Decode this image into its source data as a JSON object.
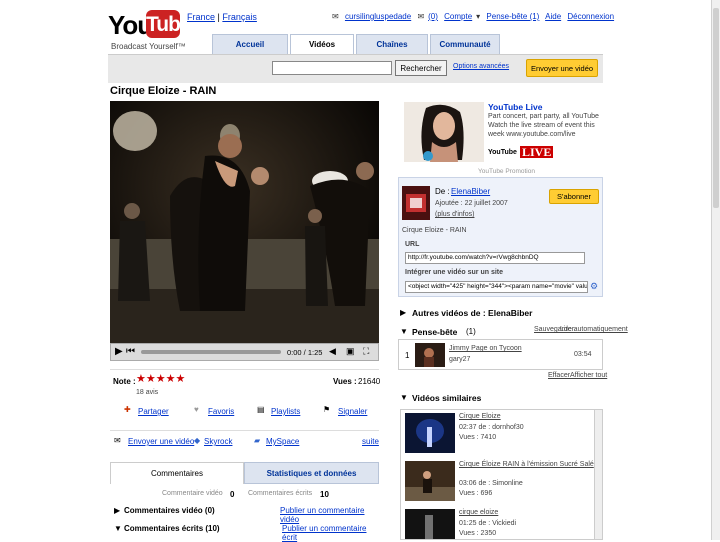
{
  "header": {
    "logo_you": "You",
    "logo_tube": "Tube",
    "tagline": "Broadcast Yourself™",
    "lang_fr": "France",
    "lang_fr2": "Français",
    "user": "cursilingluspedade",
    "inbox": "(0)",
    "account": "Compte",
    "playlist_count": "Pense-bête (1)",
    "help": "Aide",
    "logout": "Déconnexion"
  },
  "tabs": [
    "Accueil",
    "Vidéos",
    "Chaînes",
    "Communauté"
  ],
  "search": {
    "button": "Rechercher",
    "advanced": "Options avancées",
    "upload": "Envoyer une vidéo"
  },
  "video": {
    "title": "Cirque Eloize - RAIN",
    "time": "0:00 / 1:25"
  },
  "rating": {
    "label": "Note :",
    "count": "18 avis",
    "views_label": "Vues :",
    "views": "21640"
  },
  "actions": {
    "share": "Partager",
    "favorite": "Favoris",
    "playlists": "Playlists",
    "flag": "Signaler",
    "send": "Envoyer une vidéo",
    "skyrock": "Skyrock",
    "myspace": "MySpace",
    "more": "suite"
  },
  "comments_tabs": {
    "comments": "Commentaires",
    "stats": "Statistiques et données"
  },
  "comments": {
    "video_comments_label": "Commentaire vidéo",
    "video_comments_count": "0",
    "written_comments_label": "Commentaires écrits",
    "written_comments_count": "10",
    "video_row": "Commentaires vidéo (0)",
    "video_publish": "Publier un commentaire vidéo",
    "written_row": "Commentaires écrits (10)",
    "written_publish": "Publier un commentaire écrit"
  },
  "promo": {
    "title": "YouTube Live",
    "text1": "Part concert, part party, all YouTube",
    "text2": "Watch the live stream of event this",
    "text3": "week www.youtube.com/live",
    "brand": "YouTube",
    "live": "LIVE",
    "caption": "YouTube Promotion"
  },
  "channel": {
    "from_label": "De :",
    "user": "ElenaBiber",
    "added": "Ajoutée : 22 juillet 2007",
    "more": "(plus d'infos)",
    "subscribe": "S'abonner",
    "desc": "Cirque Eloize - RAIN",
    "url_label": "URL",
    "url_value": "http://fr.youtube.com/watch?v=rVwg8chbnDQ",
    "embed_label": "Intégrer une vidéo sur un site",
    "embed_value": "<object width=\"425\" height=\"344\"><param name=\"movie\" value"
  },
  "more_videos": "Autres vidéos de : ElenaBiber",
  "quicklist": {
    "title": "Pense-bête",
    "count": "(1)",
    "save": "Sauvegarder",
    "autoplay": "Lire automatiquement",
    "item_num": "1",
    "item_title": "Jimmy Page on Tycoon",
    "item_user": "gary27",
    "item_time": "03:54",
    "clear": "Effacer",
    "see_all": "Afficher tout"
  },
  "related": {
    "title": "Vidéos similaires",
    "items": [
      {
        "title": "Cirque Eloize",
        "line2": "02:37 de : dornhof30",
        "line3": "Vues : 7410"
      },
      {
        "title": "Cirque Éloize RAIN à l'émission Sucré Salé",
        "line2": "03:06 de : Simonline",
        "line3": "Vues : 696"
      },
      {
        "title": "cirque eloize",
        "line2": "01:25 de : Vickiedi",
        "line3": "Vues : 2350"
      }
    ]
  }
}
